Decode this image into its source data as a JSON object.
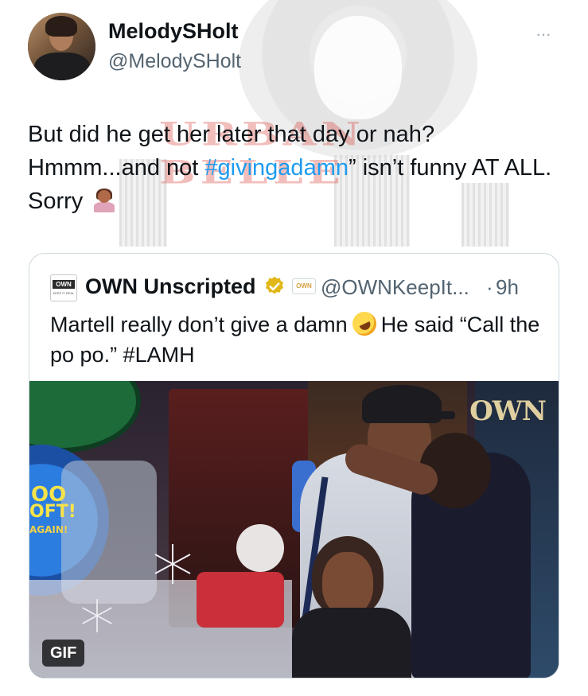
{
  "tweet": {
    "author_name": "MelodySHolt",
    "author_handle": "@MelodySHolt",
    "more_label": "···",
    "text_part1": "But did he get her later that day or nah? Hmmm...and not ",
    "hashtag": "#givingadamn",
    "text_part2": "” isn’t funny AT ALL. Sorry "
  },
  "watermark": {
    "text": "URBAN BELLE"
  },
  "quoted": {
    "logo_text": "OWN",
    "logo_subtext": "KEEP IT REAL",
    "author_name": "OWN Unscripted",
    "badge_text": "OWN",
    "author_handle": "@OWNKeepIt...",
    "separator": "·",
    "time": "9h",
    "text_part1": "Martell really don’t give a damn",
    "text_part2": "He said “Call the po po.”  #LAMH",
    "media": {
      "type_label": "GIF",
      "network_watermark": "OWN",
      "arcade_text": "OO",
      "arcade_text2": "OFT!",
      "arcade_text3": "AGAIN!"
    }
  },
  "colors": {
    "link": "#1d9bf0",
    "verified": "#e2b719",
    "secondary_text": "#536471"
  }
}
